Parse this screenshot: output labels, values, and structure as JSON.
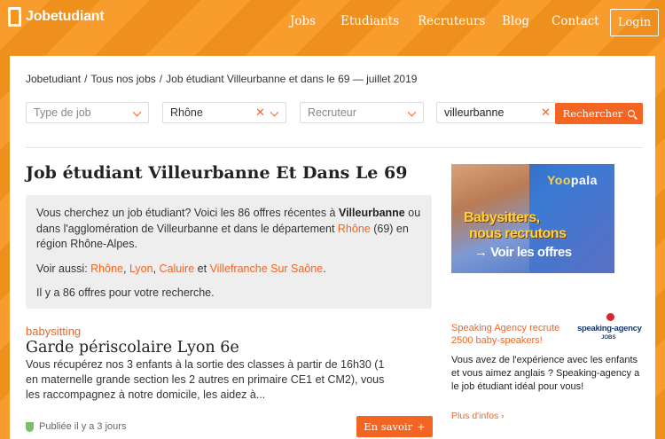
{
  "header": {
    "logo": "Jobetudiant",
    "nav": [
      "Jobs",
      "Etudiants",
      "Recruteurs",
      "Blog",
      "Contact"
    ],
    "login": "Login"
  },
  "breadcrumb": [
    "Jobetudiant",
    "Tous nos jobs",
    "Job étudiant Villeurbanne et dans le 69 — juillet 2019"
  ],
  "filters": {
    "job_type_placeholder": "Type de job",
    "region": "Rhône",
    "recruiter_placeholder": "Recruteur",
    "city": "villeurbanne",
    "search_label": "Rechercher"
  },
  "page_title": "Job étudiant Villeurbanne Et Dans Le 69",
  "intro": {
    "p1_a": "Vous cherchez un job étudiant? Voici les 86 offres récentes à ",
    "p1_city": "Villeurbanne",
    "p1_b": " ou dans l'agglomération de Villeurbanne et dans le département ",
    "p1_dept": "Rhône",
    "p1_c": " (69) en région Rhône-Alpes.",
    "see_also_label": "Voir aussi: ",
    "see_also": [
      "Rhône",
      "Lyon",
      "Caluire",
      "Villefranche Sur Saône"
    ],
    "and": "et",
    "count_text": "Il y a 86 offres pour votre recherche."
  },
  "job": {
    "category": "babysitting",
    "title": "Garde périscolaire Lyon 6e",
    "description": "Vous récupérez nos 3 enfants à la sortie des classes à partir de 16h30 (1 en maternelle grande section les 2 autres en primaire CE1 et CM2), vous les raccompagnez à notre domicile, les aidez à...",
    "published": "Publiée il y a 3 jours",
    "more_label": "En savoir",
    "more_arrow": "+"
  },
  "ad": {
    "brand_yo": "Yoo",
    "brand_rest": "pala",
    "line1": "Babysitters,",
    "line2": "nous recrutons",
    "line3": "→ Voir les offres"
  },
  "speaking_agency": {
    "headline": "Speaking Agency recrute 2500 baby-speakers!",
    "logo_name": "speaking-agency",
    "logo_sub": "JOBS",
    "text": "Vous avez de l'expérience avec les enfants et vous aimez anglais ? Speaking-agency a le job étudiant idéal pour vous!",
    "link": "Plus d'infos ›"
  },
  "colors": {
    "brand_orange": "#f7941d",
    "accent": "#f26522"
  }
}
